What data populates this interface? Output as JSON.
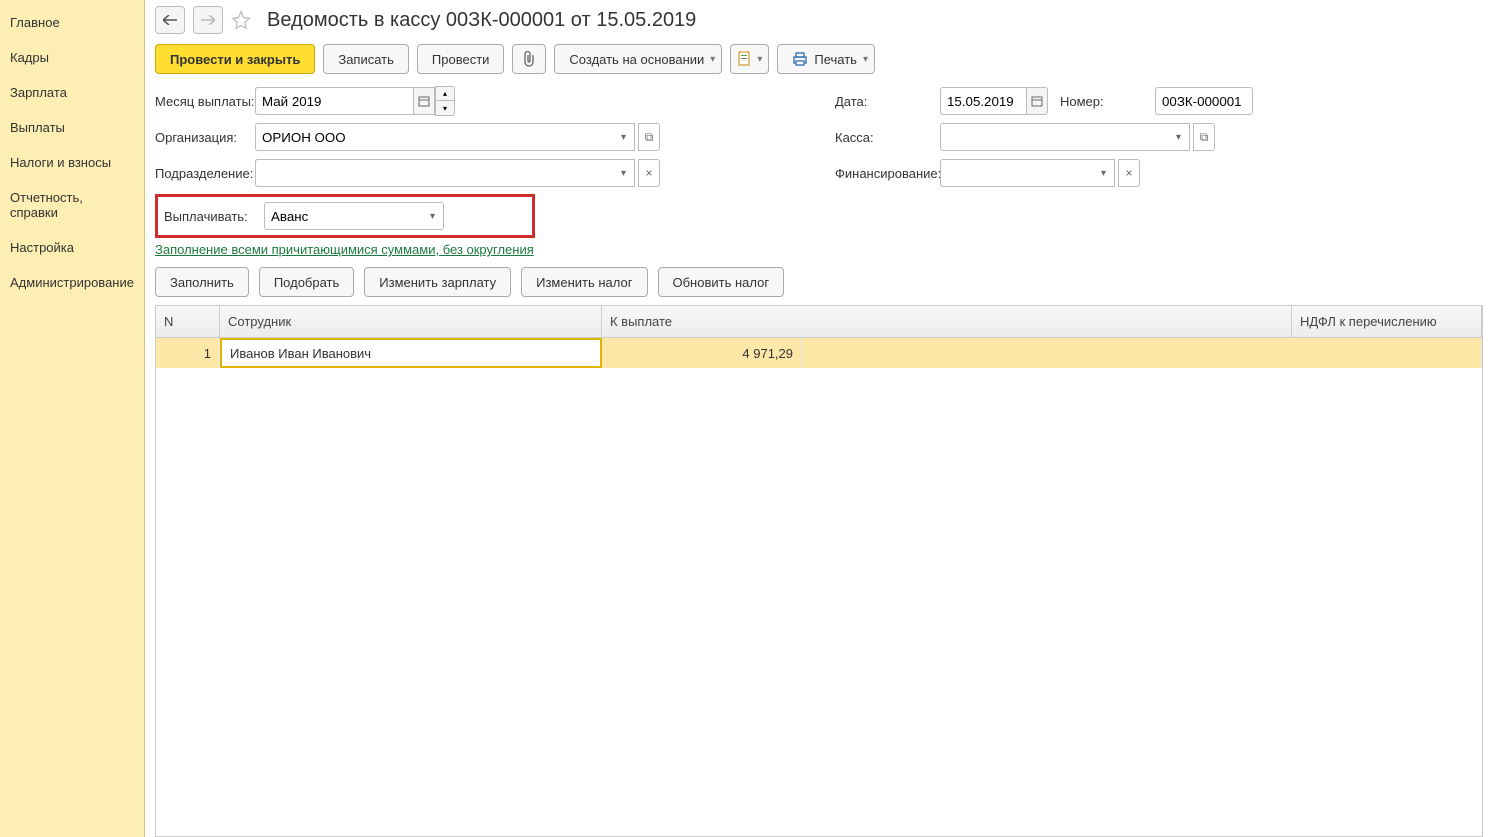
{
  "sidebar": {
    "items": [
      {
        "label": "Главное"
      },
      {
        "label": "Кадры"
      },
      {
        "label": "Зарплата"
      },
      {
        "label": "Выплаты"
      },
      {
        "label": "Налоги и взносы"
      },
      {
        "label": "Отчетность, справки"
      },
      {
        "label": "Настройка"
      },
      {
        "label": "Администрирование"
      }
    ]
  },
  "header": {
    "title": "Ведомость в кассу 00ЗК-000001 от 15.05.2019"
  },
  "toolbar": {
    "post_close": "Провести и закрыть",
    "write": "Записать",
    "post": "Провести",
    "create_based": "Создать на основании",
    "print": "Печать"
  },
  "form": {
    "month_label": "Месяц выплаты:",
    "month_value": "Май 2019",
    "org_label": "Организация:",
    "org_value": "ОРИОН ООО",
    "dept_label": "Подразделение:",
    "dept_value": "",
    "pay_label": "Выплачивать:",
    "pay_value": "Аванс",
    "date_label": "Дата:",
    "date_value": "15.05.2019",
    "num_label": "Номер:",
    "num_value": "00ЗК-000001",
    "cash_label": "Касса:",
    "cash_value": "",
    "fin_label": "Финансирование:",
    "fin_value": ""
  },
  "link_text": "Заполнение всеми причитающимися суммами, без округления",
  "toolbar2": {
    "fill": "Заполнить",
    "pick": "Подобрать",
    "change_salary": "Изменить зарплату",
    "change_tax": "Изменить налог",
    "update_tax": "Обновить налог"
  },
  "table": {
    "headers": {
      "n": "N",
      "emp": "Сотрудник",
      "pay": "К выплате",
      "ndfl": "НДФЛ к перечислению"
    },
    "rows": [
      {
        "n": "1",
        "emp": "Иванов Иван Иванович",
        "pay": "4 971,29",
        "ndfl": ""
      }
    ]
  }
}
